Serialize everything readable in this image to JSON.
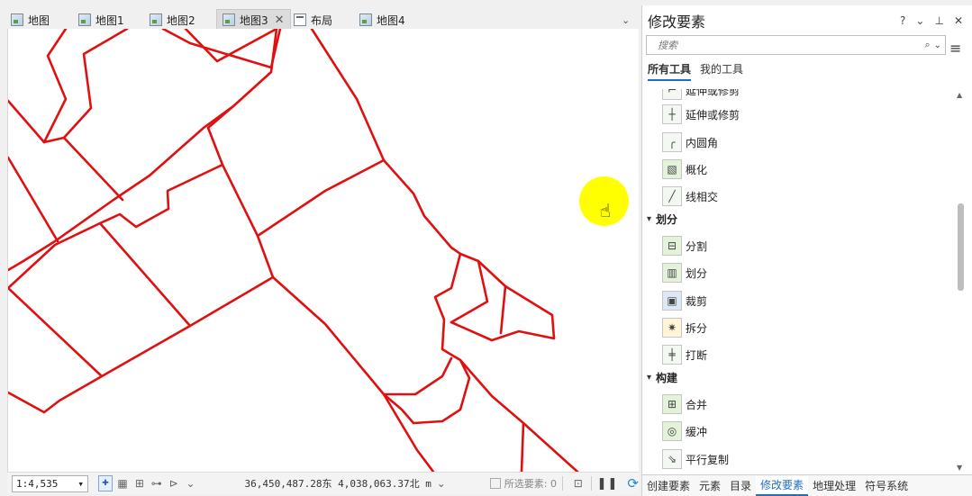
{
  "map_tabs": [
    {
      "label": "地图"
    },
    {
      "label": "地图1"
    },
    {
      "label": "地图2"
    },
    {
      "label": "地图3",
      "active": true,
      "close": "✕"
    },
    {
      "label": "布局"
    },
    {
      "label": "地图4"
    }
  ],
  "tab_overflow": "⌄",
  "status": {
    "scale": "1:4,535",
    "coords": "36,450,487.28东 4,038,063.37北 m",
    "coords_dropdown": "⌄",
    "selected": "所选要素: 0"
  },
  "pane": {
    "title": "修改要素",
    "controls": [
      "?",
      "⌄",
      "⊥",
      "✕"
    ],
    "search_placeholder": "搜索",
    "tabs": [
      "所有工具",
      "我的工具"
    ],
    "partial_tool": "延伸或修剪",
    "tools_top": [
      {
        "label": "延伸或修剪",
        "icon": "extend-trim-icon"
      },
      {
        "label": "内圆角",
        "icon": "fillet-icon"
      },
      {
        "label": "概化",
        "icon": "generalize-icon"
      },
      {
        "label": "线相交",
        "icon": "line-intersection-icon"
      }
    ],
    "group_divide": "划分",
    "tools_divide": [
      {
        "label": "分割",
        "icon": "split-icon"
      },
      {
        "label": "划分",
        "icon": "divide-icon"
      },
      {
        "label": "裁剪",
        "icon": "clip-icon"
      },
      {
        "label": "拆分",
        "icon": "explode-icon"
      },
      {
        "label": "打断",
        "icon": "break-icon"
      }
    ],
    "group_construct": "构建",
    "tools_construct": [
      {
        "label": "合并",
        "icon": "merge-icon"
      },
      {
        "label": "缓冲",
        "icon": "buffer-icon"
      },
      {
        "label": "平行复制",
        "icon": "parallel-copy-icon"
      }
    ],
    "bottom_tabs": [
      "创建要素",
      "元素",
      "目录",
      "修改要素",
      "地理处理",
      "符号系统"
    ]
  },
  "colors": {
    "parcel_line": "#e01010",
    "cursor_halo": "#ffff00",
    "accent": "#1e6fc4"
  }
}
